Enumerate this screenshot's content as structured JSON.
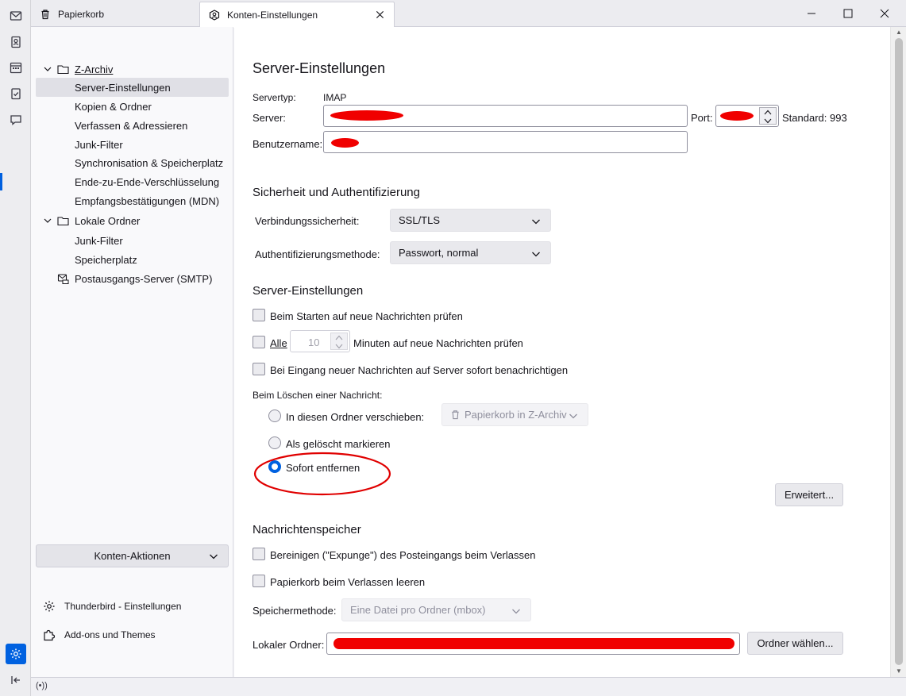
{
  "spaces": {
    "items": [
      {
        "icon": "mail-icon"
      },
      {
        "icon": "address-book-icon"
      },
      {
        "icon": "calendar-icon"
      },
      {
        "icon": "tasks-icon"
      },
      {
        "icon": "chat-icon"
      }
    ],
    "settings_icon": "gear-icon",
    "collapse_icon": "collapse-sidebar-icon"
  },
  "tabs": [
    {
      "label": "Papierkorb",
      "icon": "trash-icon"
    },
    {
      "label": "Konten-Einstellungen",
      "icon": "account-settings-icon",
      "active": true
    }
  ],
  "sidebar": {
    "tree": [
      {
        "label": "Z-Archiv",
        "level": 0,
        "expanded": true,
        "icon": "folder-icon"
      },
      {
        "label": "Server-Einstellungen",
        "level": 1,
        "selected": true
      },
      {
        "label": "Kopien & Ordner",
        "level": 1
      },
      {
        "label": "Verfassen & Adressieren",
        "level": 1
      },
      {
        "label": "Junk-Filter",
        "level": 1
      },
      {
        "label": "Synchronisation & Speicherplatz",
        "level": 1
      },
      {
        "label": "Ende-zu-Ende-Verschlüsselung",
        "level": 1
      },
      {
        "label": "Empfangsbestätigungen (MDN)",
        "level": 1
      },
      {
        "label": "Lokale Ordner",
        "level": 0,
        "expanded": true,
        "icon": "folder-icon"
      },
      {
        "label": "Junk-Filter",
        "level": 1
      },
      {
        "label": "Speicherplatz",
        "level": 1
      },
      {
        "label": "Postausgangs-Server (SMTP)",
        "level": 0,
        "icon": "outgoing-server-icon"
      }
    ],
    "account_actions_label": "Konten-Aktionen",
    "links": [
      {
        "label": "Thunderbird - Einstellungen",
        "icon": "gear-icon"
      },
      {
        "label": "Add-ons und Themes",
        "icon": "puzzle-icon"
      }
    ]
  },
  "main": {
    "title": "Server-Einstellungen",
    "servertype_label": "Servertyp:",
    "servertype_value": "IMAP",
    "server_label": "Server:",
    "port_label": "Port:",
    "standard_label": "Standard: 993",
    "username_label": "Benutzername:",
    "security": {
      "heading": "Sicherheit und Authentifizierung",
      "connection_label": "Verbindungssicherheit:",
      "connection_value": "SSL/TLS",
      "auth_label": "Authentifizierungsmethode:",
      "auth_value": "Passwort, normal"
    },
    "server_settings": {
      "heading": "Server-Einstellungen",
      "check_on_start": "Beim Starten auf neue Nachrichten prüfen",
      "check_every_prefix": "Alle",
      "check_every_value": "10",
      "check_every_suffix": "Minuten auf neue Nachrichten prüfen",
      "notify_immediately": "Bei Eingang neuer Nachrichten auf Server sofort benachrichtigen",
      "on_delete_label": "Beim Löschen einer Nachricht:",
      "delete_move": "In diesen Ordner verschieben:",
      "delete_move_target": "Papierkorb in Z-Archiv",
      "delete_mark": "Als gelöscht markieren",
      "delete_remove": "Sofort entfernen",
      "selected_option": "Sofort entfernen",
      "advanced_button": "Erweitert..."
    },
    "storage": {
      "heading": "Nachrichtenspeicher",
      "expunge": "Bereinigen (\"Expunge\") des Posteingangs beim Verlassen",
      "empty_trash": "Papierkorb beim Verlassen leeren",
      "method_label": "Speichermethode:",
      "method_value": "Eine Datei pro Ordner (mbox)",
      "local_folder_label": "Lokaler Ordner:",
      "choose_folder_button": "Ordner wählen..."
    }
  },
  "colors": {
    "accent": "#0061e0",
    "annotation": "#e00000",
    "redaction": "#f00000"
  }
}
